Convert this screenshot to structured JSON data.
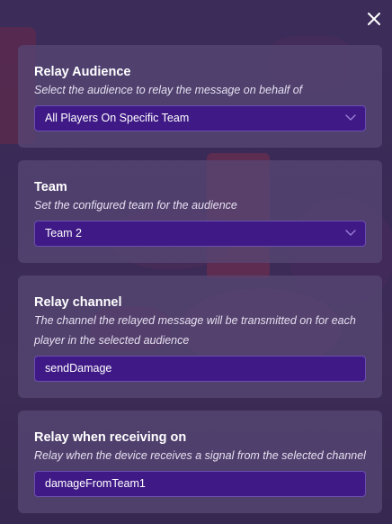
{
  "window": {
    "close_icon": "close-icon"
  },
  "sections": [
    {
      "title": "Relay Audience",
      "description": "Select the audience to relay the message on behalf of",
      "control": "dropdown",
      "value": "All Players On Specific Team"
    },
    {
      "title": "Team",
      "description": "Set the configured team for the audience",
      "control": "dropdown",
      "value": "Team 2"
    },
    {
      "title": "Relay channel",
      "description_line1": "The channel the relayed message will be transmitted on for each",
      "description_line2": "player in the selected audience",
      "control": "text",
      "value": "sendDamage"
    },
    {
      "title": "Relay when receiving on",
      "description": "Relay when the device receives a signal from the selected channel",
      "control": "text",
      "value": "damageFromTeam1"
    }
  ],
  "colors": {
    "card_bg": "#584876",
    "field_bg": "#3f1a86",
    "field_border": "#6c4fb0",
    "chevron": "#9a7fd6"
  }
}
